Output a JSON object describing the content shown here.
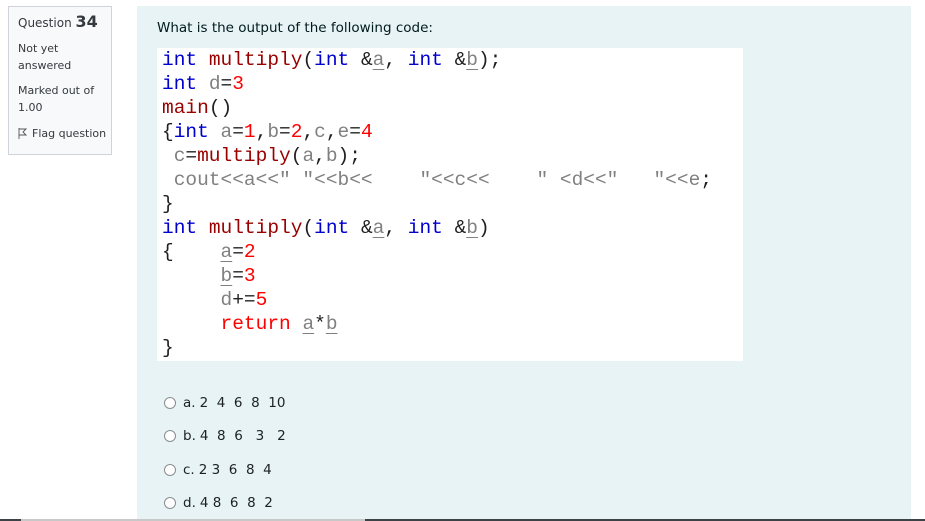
{
  "info": {
    "question_label": "Question",
    "question_number": "34",
    "state": "Not yet answered",
    "grade": "Marked out of 1.00",
    "flag_label": "Flag question",
    "flag_icon": "flag-icon"
  },
  "question": {
    "text": "What is the output of the following code:",
    "code_lines": [
      "int multiply(int &a, int &b);",
      "int d=3",
      "main()",
      "{int a=1,b=2,c,e=4",
      " c=multiply(a,b);",
      " cout<<a<<\" \"<<b<<    \"<<c<<    \" <d<<\"   \"<<e;",
      "}",
      "int multiply(int &a, int &b)",
      "{    a=2",
      "     b=3",
      "     d+=5",
      "     return a*b",
      "}"
    ],
    "colors": {
      "keyword": "#0000cc",
      "function": "#990000",
      "number": "#ff0000",
      "variable": "#808080"
    }
  },
  "options": [
    {
      "label": "a.",
      "value": "2  4  6  8  10"
    },
    {
      "label": "b.",
      "value": "4  8  6   3   2"
    },
    {
      "label": "c.",
      "value": "2 3  6  8  4"
    },
    {
      "label": "d.",
      "value": "4 8  6  8  2"
    }
  ]
}
